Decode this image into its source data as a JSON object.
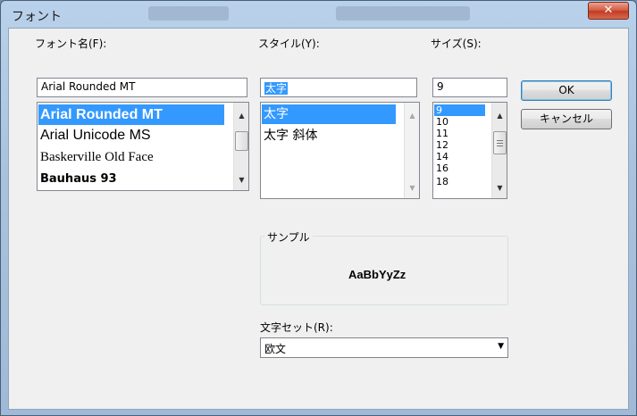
{
  "window": {
    "title": "フォント",
    "close_glyph": "✕"
  },
  "font_name": {
    "label": "フォント名(F):",
    "value": "Arial Rounded MT",
    "items": [
      {
        "label": "Arial Rounded MT",
        "selected": true
      },
      {
        "label": "Arial Unicode MS",
        "selected": false
      },
      {
        "label": "Baskerville Old Face",
        "selected": false
      },
      {
        "label": "Bauhaus 93",
        "selected": false
      }
    ]
  },
  "style": {
    "label": "スタイル(Y):",
    "value": "太字",
    "items": [
      {
        "label": "太字",
        "selected": true
      },
      {
        "label": "太字 斜体",
        "selected": false
      }
    ]
  },
  "size": {
    "label": "サイズ(S):",
    "value": "9",
    "items": [
      {
        "label": "9",
        "selected": true
      },
      {
        "label": "10",
        "selected": false
      },
      {
        "label": "11",
        "selected": false
      },
      {
        "label": "12",
        "selected": false
      },
      {
        "label": "14",
        "selected": false
      },
      {
        "label": "16",
        "selected": false
      },
      {
        "label": "18",
        "selected": false
      }
    ]
  },
  "buttons": {
    "ok": "OK",
    "cancel": "キャンセル"
  },
  "sample": {
    "label": "サンプル",
    "text": "AaBbYyZz"
  },
  "charset": {
    "label": "文字セット(R):",
    "value": "欧文"
  },
  "icons": {
    "scroll_up": "▲",
    "scroll_down": "▼",
    "dropdown": "▼"
  },
  "colors": {
    "selection": "#3399ff",
    "close": "#c13b22",
    "title_bar": "#b9d1ea"
  }
}
